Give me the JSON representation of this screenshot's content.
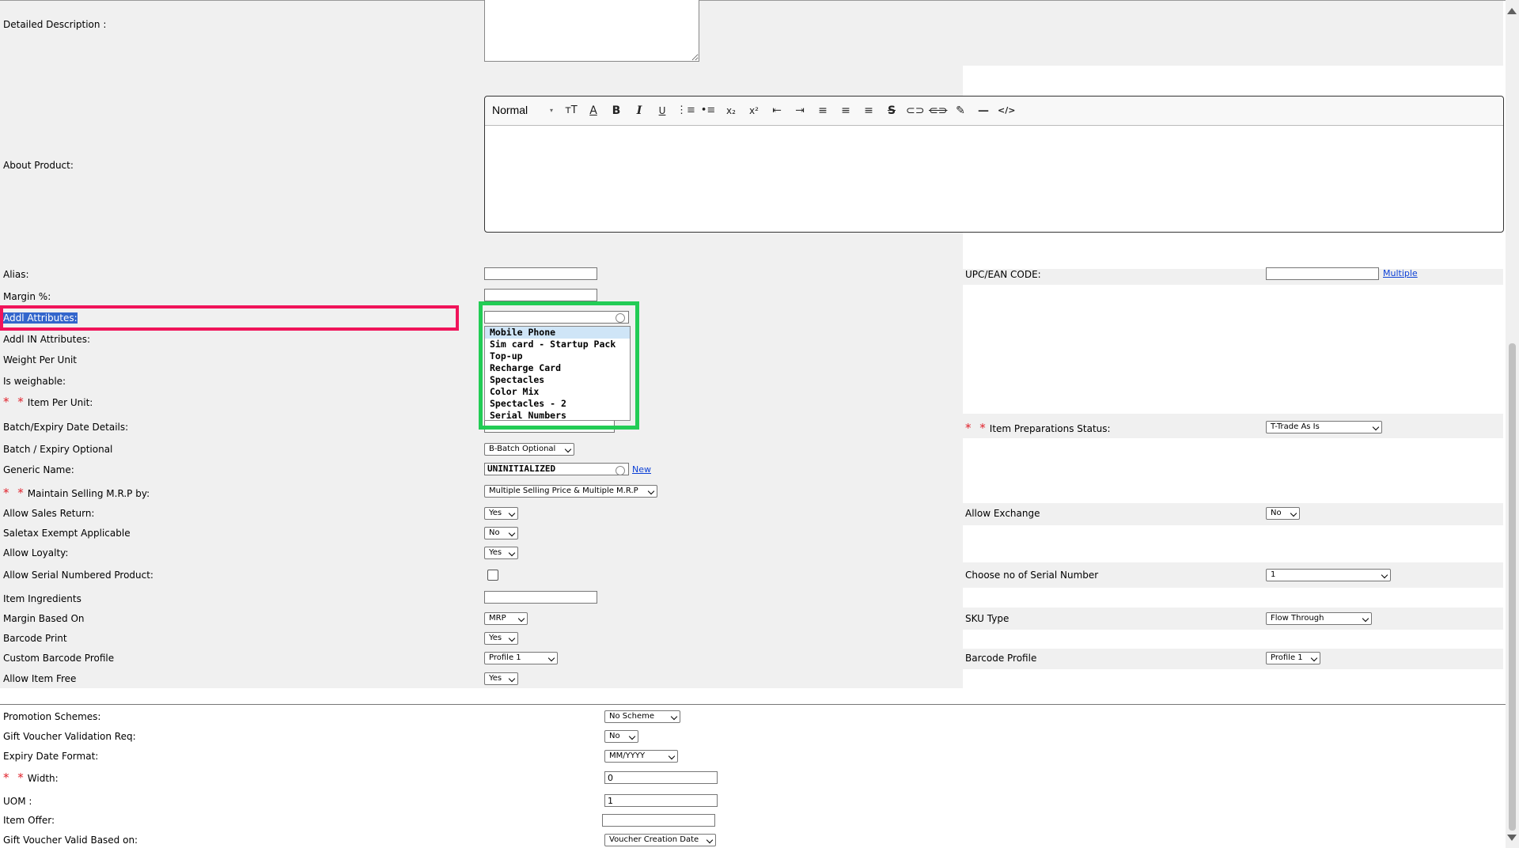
{
  "labels": {
    "detailed_description": "Detailed Description :",
    "about_product": "About Product:",
    "alias": "Alias:",
    "margin_pct": "Margin %:",
    "addl_attributes": "Addl Attributes:",
    "addl_in_attributes": "Addl IN Attributes:",
    "weight_per_unit": "Weight Per Unit",
    "is_weighable": "Is weighable:",
    "item_per_unit": "Item Per Unit:",
    "batch_expiry_details": "Batch/Expiry Date Details:",
    "batch_expiry_optional": "Batch / Expiry Optional",
    "generic_name": "Generic Name:",
    "maintain_selling_mrp": "Maintain Selling M.R.P by:",
    "allow_sales_return": "Allow Sales Return:",
    "saletax_exempt": "Saletax Exempt Applicable",
    "allow_loyalty": "Allow Loyalty:",
    "allow_serial_numbered": "Allow Serial Numbered Product:",
    "item_ingredients": "Item Ingredients",
    "margin_based_on": "Margin Based On",
    "barcode_print": "Barcode Print",
    "custom_barcode_profile": "Custom Barcode Profile",
    "allow_item_free": "Allow Item Free",
    "promotion_schemes": "Promotion Schemes:",
    "gift_voucher_validation": "Gift Voucher Validation Req:",
    "expiry_date_format": "Expiry Date Format:",
    "width": "Width:",
    "uom": "UOM :",
    "item_offer": "Item Offer:",
    "gift_voucher_valid_based": "Gift Voucher Valid Based on:",
    "upc_ean": "UPC/EAN CODE:",
    "item_preparations_status": "Item Preparations Status:",
    "allow_exchange": "Allow Exchange",
    "choose_serial_number": "Choose no of Serial Number",
    "sku_type": "SKU Type",
    "barcode_profile": "Barcode Profile"
  },
  "required_mark": "* *",
  "links": {
    "multiple": "Multiple",
    "new": "New"
  },
  "editor": {
    "format": "Normal"
  },
  "values": {
    "generic_name": "UNINITIALIZED",
    "batch_expiry_optional": "B-Batch Optional",
    "maintain_selling_mrp": "Multiple Selling Price & Multiple M.R.P",
    "allow_sales_return": "Yes",
    "saletax_exempt": "No",
    "allow_loyalty": "Yes",
    "margin_based_on": "MRP",
    "barcode_print": "Yes",
    "custom_barcode_profile": "Profile 1",
    "allow_item_free": "Yes",
    "promotion_schemes": "No Scheme",
    "gift_voucher_validation": "No",
    "expiry_date_format": "MM/YYYY",
    "width": "0",
    "uom": "1",
    "gift_voucher_valid_based": "Voucher Creation Date",
    "item_preparations_status": "T-Trade As Is",
    "allow_exchange": "No",
    "choose_serial_number": "1",
    "sku_type": "Flow Through",
    "barcode_profile": "Profile 1"
  },
  "attribute_options": [
    "Mobile Phone",
    "Sim card - Startup Pack",
    "Top-up",
    "Recharge Card",
    "Spectacles",
    "Color Mix",
    "Spectacles - 2",
    "Serial Numbers"
  ],
  "colors": {
    "highlight_red": "#f0145a",
    "highlight_green": "#22cc55",
    "required": "#e0202a"
  }
}
